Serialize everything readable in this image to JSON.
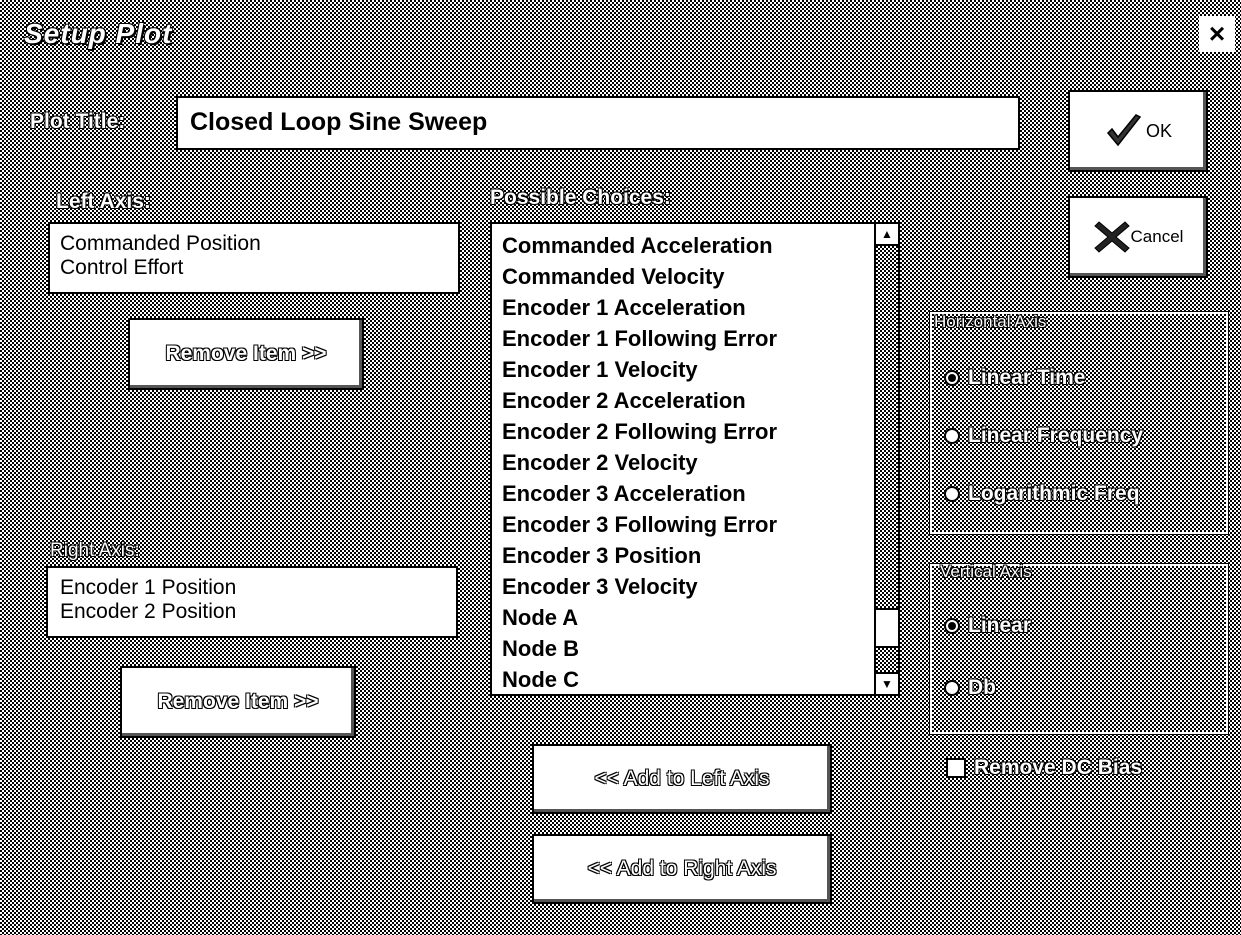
{
  "dialog": {
    "title": "Setup Plot",
    "close_label": "×"
  },
  "plot_title": {
    "label": "Plot Title:",
    "value": "Closed Loop Sine Sweep"
  },
  "buttons": {
    "ok": "OK",
    "cancel": "Cancel"
  },
  "left_axis": {
    "label": "Left Axis:",
    "items": [
      "Commanded Position",
      "Control Effort"
    ],
    "remove_button": "Remove Item >>"
  },
  "right_axis": {
    "label": "Right Axis:",
    "items": [
      "Encoder 1 Position",
      "Encoder 2 Position"
    ],
    "remove_button": "Remove Item >>"
  },
  "choices": {
    "label": "Possible Choices:",
    "items": [
      "Commanded Acceleration",
      "Commanded Velocity",
      "Encoder 1 Acceleration",
      "Encoder 1 Following Error",
      "Encoder 1 Velocity",
      "Encoder 2 Acceleration",
      "Encoder 2 Following Error",
      "Encoder 2 Velocity",
      "Encoder 3 Acceleration",
      "Encoder 3 Following Error",
      "Encoder 3 Position",
      "Encoder 3 Velocity",
      "Node A",
      "Node B",
      "Node C"
    ],
    "add_left": "<< Add to Left Axis",
    "add_right": "<< Add to Right Axis"
  },
  "horizontal_axis": {
    "label": "Horizontal Axis",
    "options": [
      "Linear Time",
      "Linear Frequency",
      "Logarithmic Freq"
    ],
    "selected": "Linear Time"
  },
  "vertical_axis": {
    "label": "Vertical Axis",
    "options": [
      "Linear",
      "Db"
    ],
    "selected": "Linear"
  },
  "remove_dc_bias": {
    "label": "Remove DC Bias",
    "checked": false
  }
}
